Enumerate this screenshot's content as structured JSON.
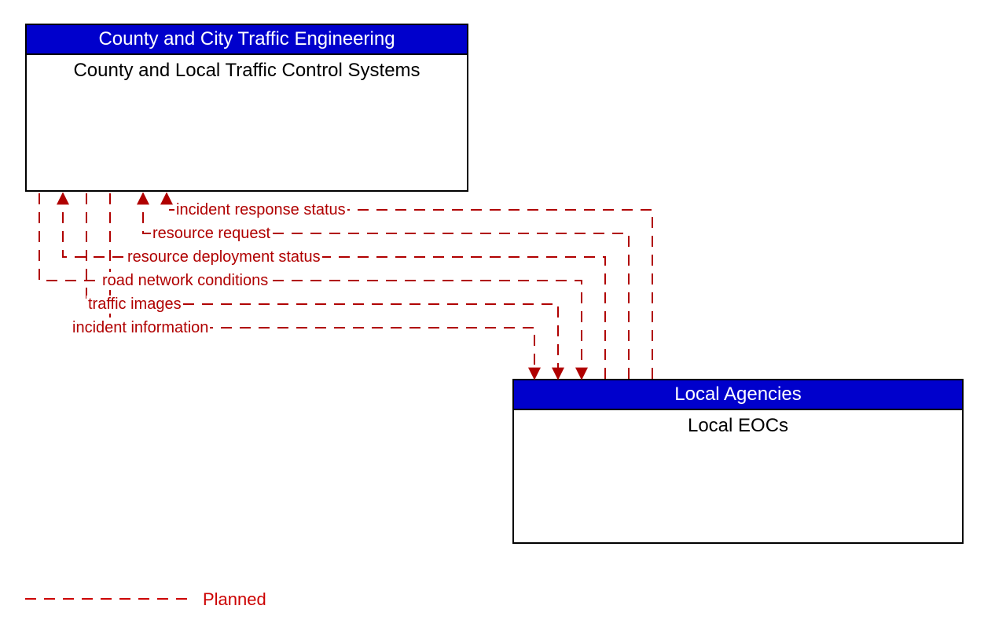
{
  "boxes": {
    "top": {
      "header": "County and City Traffic Engineering",
      "body": "County and Local Traffic Control Systems"
    },
    "bottom": {
      "header": "Local Agencies",
      "body": "Local EOCs"
    }
  },
  "flows": {
    "f1": "incident response status",
    "f2": "resource request",
    "f3": "resource deployment status",
    "f4": "road network conditions",
    "f5": "traffic images",
    "f6": "incident information"
  },
  "legend": {
    "planned": "Planned"
  },
  "colors": {
    "arrow": "#b00000",
    "header_bg": "#0000cc"
  }
}
